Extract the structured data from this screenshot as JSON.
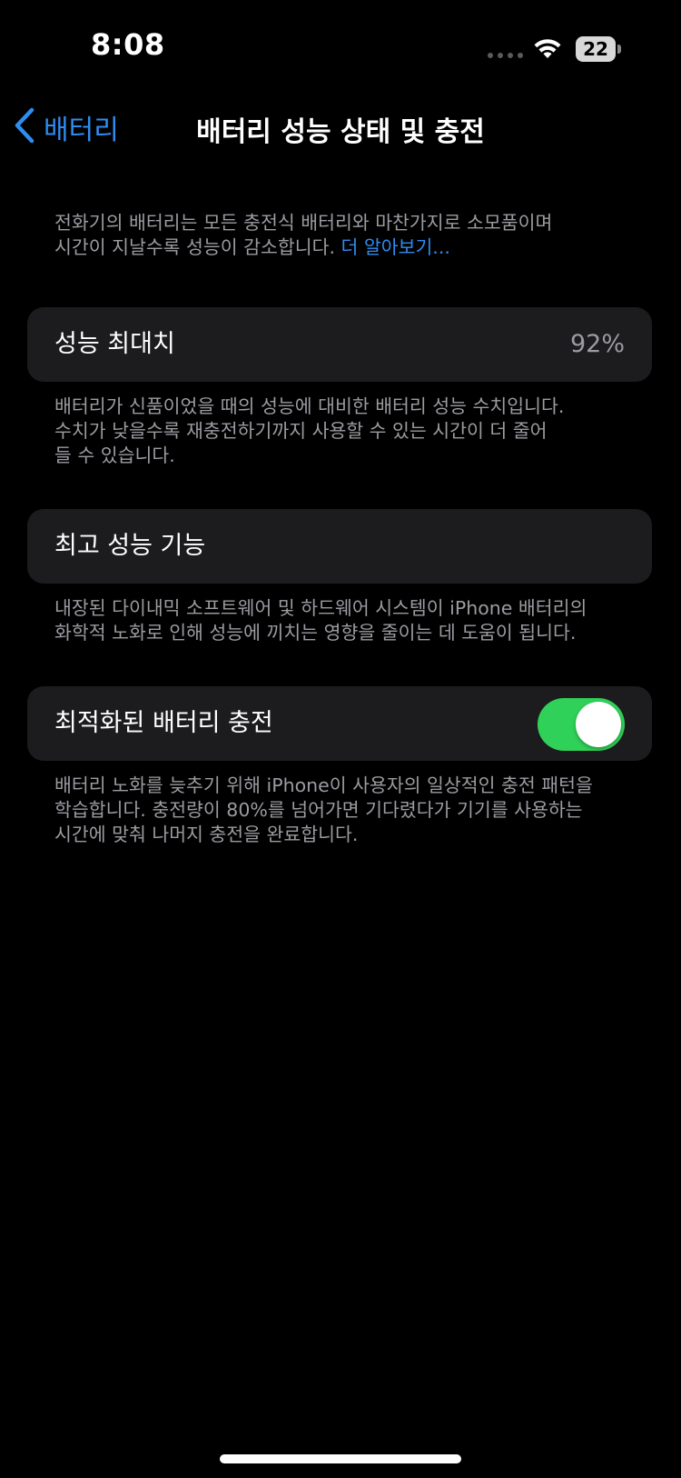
{
  "status_bar": {
    "time": "8:08",
    "battery_level": "22"
  },
  "nav": {
    "back_label": "배터리",
    "title": "배터리 성능 상태 및 충전"
  },
  "intro": {
    "line1": "전화기의 배터리는 모든 충전식 배터리와 마찬가지로 소모품이며",
    "line2": "시간이 지날수록 성능이 감소합니다. ",
    "link": "더 알아보기..."
  },
  "max_capacity": {
    "label": "성능 최대치",
    "value": "92%",
    "desc_line1": "배터리가 신품이었을 때의 성능에 대비한 배터리 성능 수치입니다.",
    "desc_line2": "수치가 낮을수록 재충전하기까지 사용할 수 있는 시간이 더 줄어",
    "desc_line3": "들 수 있습니다."
  },
  "peak_performance": {
    "label": "최고 성능 기능",
    "desc_line1": "내장된 다이내믹 소프트웨어 및 하드웨어 시스템이 iPhone 배터리의",
    "desc_line2": "화학적 노화로 인해 성능에 끼치는 영향을 줄이는 데 도움이 됩니다."
  },
  "optimized_charging": {
    "label": "최적화된 배터리 충전",
    "enabled": true,
    "desc_line1": "배터리 노화를 늦추기 위해 iPhone이 사용자의 일상적인 충전 패턴을",
    "desc_line2": "학습합니다. 충전량이 80%를 넘어가면 기다렸다가 기기를 사용하는",
    "desc_line3": "시간에 맞춰 나머지 충전을 완료합니다."
  },
  "colors": {
    "background": "#000000",
    "card": "#1c1c1e",
    "accent_blue": "#2f8cf0",
    "toggle_on": "#30d158",
    "secondary_text": "#9b9ba1"
  }
}
